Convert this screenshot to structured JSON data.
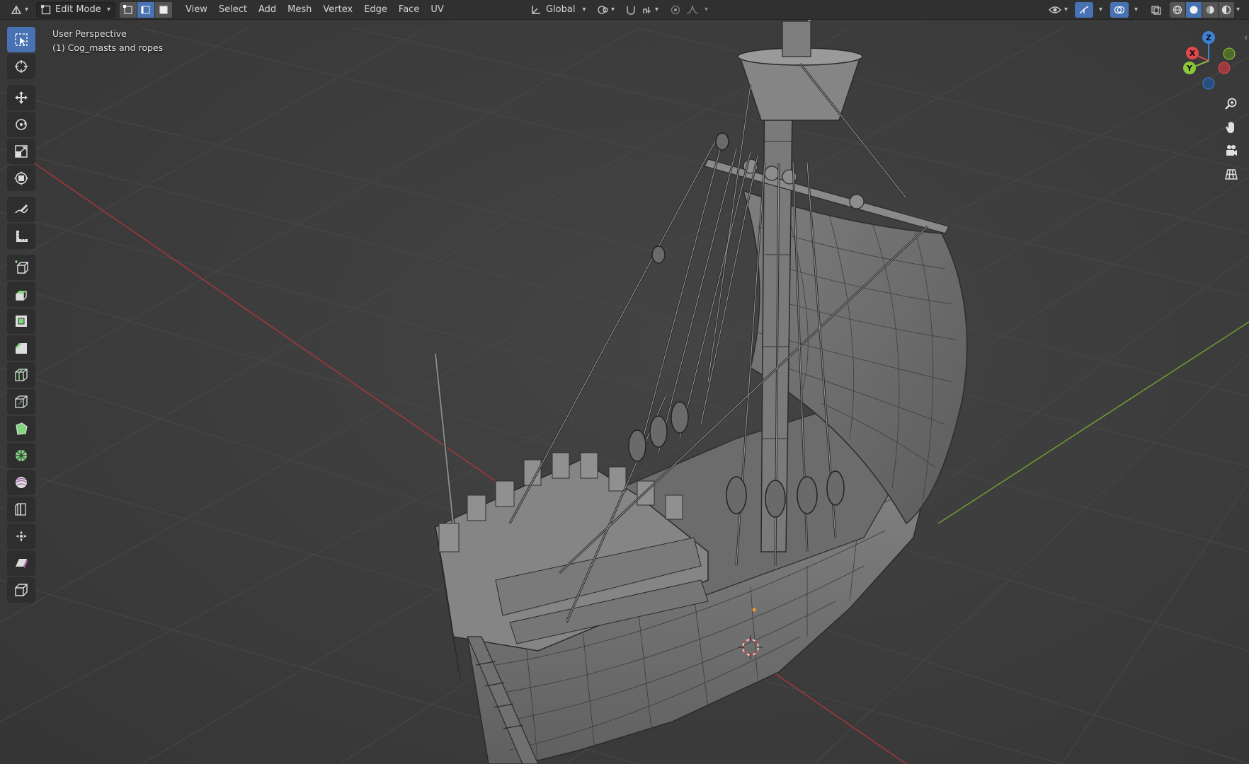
{
  "header": {
    "mode": "Edit Mode",
    "menus": [
      "View",
      "Select",
      "Add",
      "Mesh",
      "Vertex",
      "Edge",
      "Face",
      "UV"
    ],
    "orientation": "Global"
  },
  "viewport": {
    "view_name": "User Perspective",
    "object_name": "(1) Cog_masts and ropes"
  },
  "gizmo": {
    "z": "Z",
    "x": "X",
    "y": "Y"
  },
  "colors": {
    "accent": "#4772b3",
    "header_bg": "#303030",
    "viewport_bg": "#3d3d3d",
    "x_axis": "#e0484f",
    "y_axis": "#8bc83a",
    "z_axis": "#3d82d6"
  },
  "icons": {
    "tools": [
      "select-box-icon",
      "cursor-icon",
      "move-icon",
      "rotate-icon",
      "scale-icon",
      "transform-icon",
      "annotate-icon",
      "measure-icon",
      "add-cube-icon",
      "extrude-icon",
      "inset-icon",
      "bevel-icon",
      "loop-cut-icon",
      "knife-icon",
      "poly-build-icon",
      "spin-icon",
      "smooth-icon",
      "edge-slide-icon",
      "shrink-fatten-icon",
      "shear-icon",
      "rip-icon"
    ],
    "nav": [
      "zoom-icon",
      "pan-hand-icon",
      "camera-icon",
      "grid-view-icon"
    ]
  }
}
